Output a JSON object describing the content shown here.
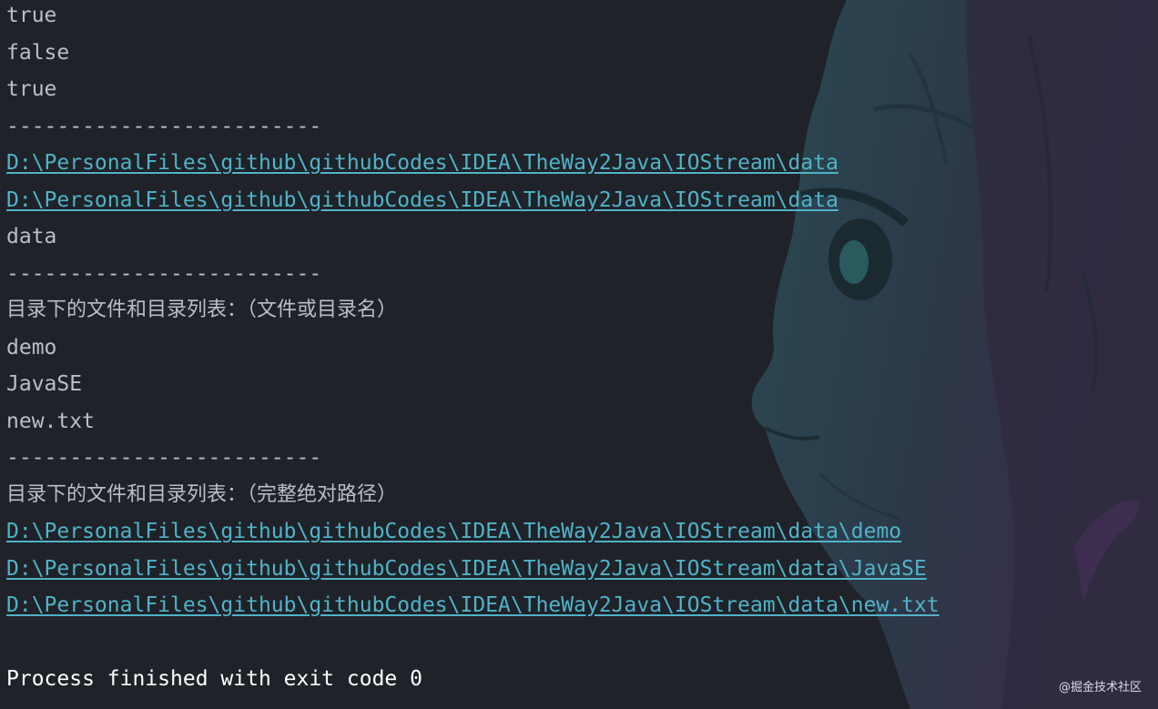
{
  "console": {
    "lines": [
      {
        "kind": "text",
        "text": "true"
      },
      {
        "kind": "text",
        "text": "false"
      },
      {
        "kind": "text",
        "text": "true"
      },
      {
        "kind": "sep",
        "text": "-------------------------"
      },
      {
        "kind": "link",
        "text": "D:\\PersonalFiles\\github\\githubCodes\\IDEA\\TheWay2Java\\IOStream\\data"
      },
      {
        "kind": "link",
        "text": "D:\\PersonalFiles\\github\\githubCodes\\IDEA\\TheWay2Java\\IOStream\\data"
      },
      {
        "kind": "text",
        "text": "data"
      },
      {
        "kind": "sep",
        "text": "-------------------------"
      },
      {
        "kind": "cjk",
        "text": "目录下的文件和目录列表：（文件或目录名）"
      },
      {
        "kind": "text",
        "text": "demo"
      },
      {
        "kind": "text",
        "text": "JavaSE"
      },
      {
        "kind": "text",
        "text": "new.txt"
      },
      {
        "kind": "sep",
        "text": "-------------------------"
      },
      {
        "kind": "cjk",
        "text": "目录下的文件和目录列表：（完整绝对路径）"
      },
      {
        "kind": "link",
        "text": "D:\\PersonalFiles\\github\\githubCodes\\IDEA\\TheWay2Java\\IOStream\\data\\demo"
      },
      {
        "kind": "link",
        "text": "D:\\PersonalFiles\\github\\githubCodes\\IDEA\\TheWay2Java\\IOStream\\data\\JavaSE"
      },
      {
        "kind": "link",
        "text": "D:\\PersonalFiles\\github\\githubCodes\\IDEA\\TheWay2Java\\IOStream\\data\\new.txt"
      },
      {
        "kind": "blank",
        "text": ""
      },
      {
        "kind": "final",
        "text": "Process finished with exit code 0"
      }
    ]
  },
  "watermark": "@掘金技术社区",
  "colors": {
    "background": "#1f2228",
    "text": "#bcbec4",
    "link": "#4fb3c8",
    "final_text": "#ffffff"
  },
  "icons": {
    "background_art": "groot-face-illustration"
  }
}
